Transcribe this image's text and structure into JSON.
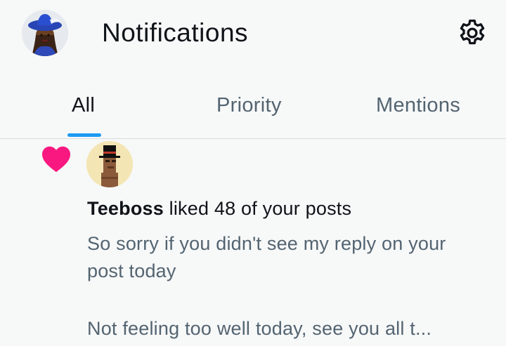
{
  "header": {
    "title": "Notifications",
    "avatar_icon": "profile-avatar-icon",
    "settings_icon": "gear-icon"
  },
  "tabs": [
    {
      "label": "All",
      "selected": true
    },
    {
      "label": "Priority",
      "selected": false
    },
    {
      "label": "Mentions",
      "selected": false
    }
  ],
  "notification": {
    "type_icon": "heart-icon",
    "actor_name": "Teeboss",
    "action_text": " liked 48 of your posts",
    "post_preview": "So sorry if you didn't see my reply on your post today",
    "post_preview_2": "Not feeling too well today, see you all t..."
  },
  "colors": {
    "accent": "#1d9bf0",
    "like": "#f91880",
    "secondary_text": "#536471",
    "primary_text": "#0f1419",
    "background": "#f7f8f8"
  }
}
